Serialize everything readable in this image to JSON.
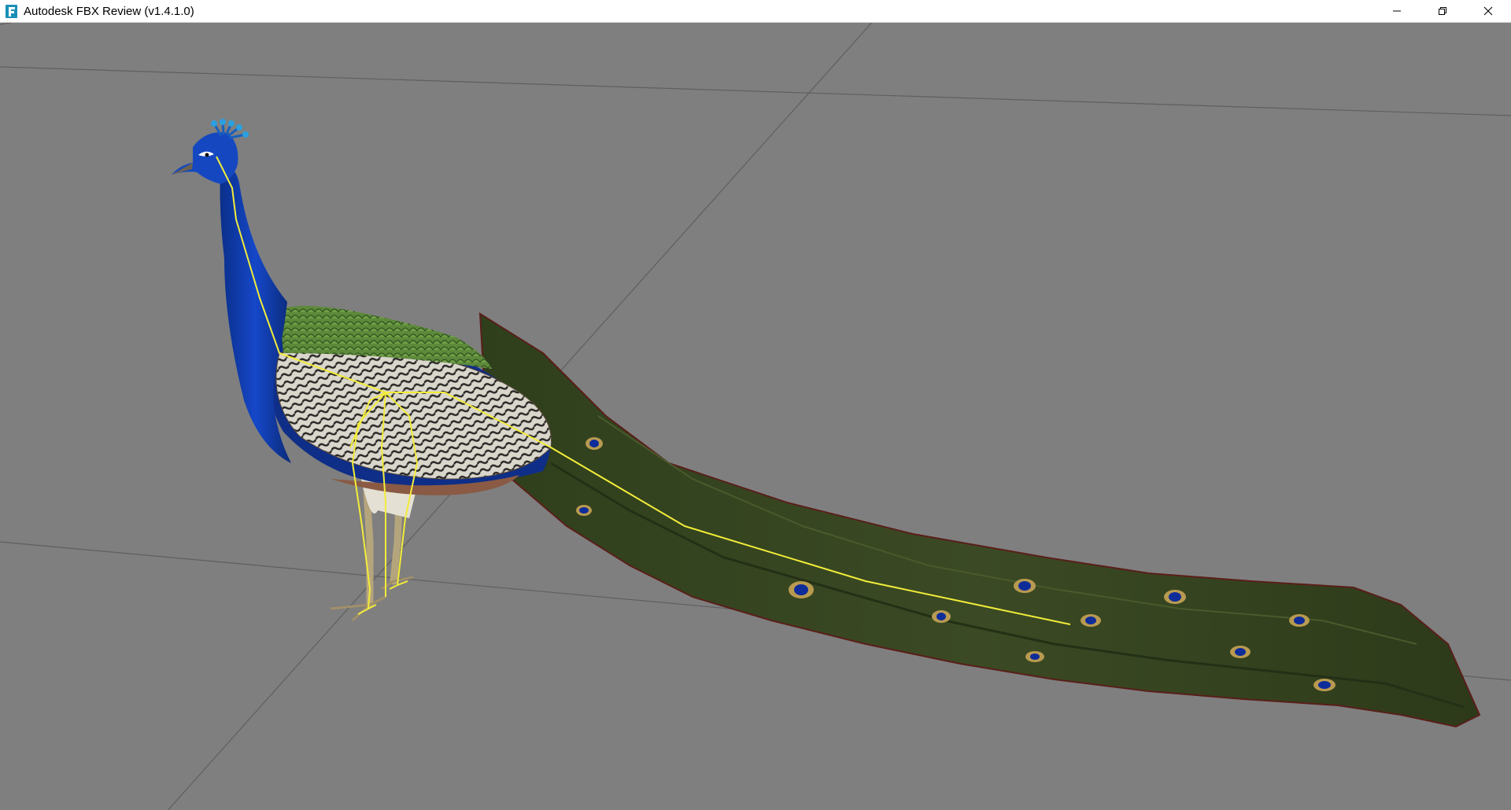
{
  "window": {
    "title": "Autodesk FBX Review (v1.4.1.0)",
    "app_icon": "fbx-review-logo-icon",
    "controls": [
      "minimize-icon",
      "restore-icon",
      "close-icon"
    ]
  },
  "viewport": {
    "background_color": "#7f7f7f",
    "grid_color": "#5e5e5e",
    "skeleton_color": "#f2ec3a",
    "model": "peacock"
  }
}
